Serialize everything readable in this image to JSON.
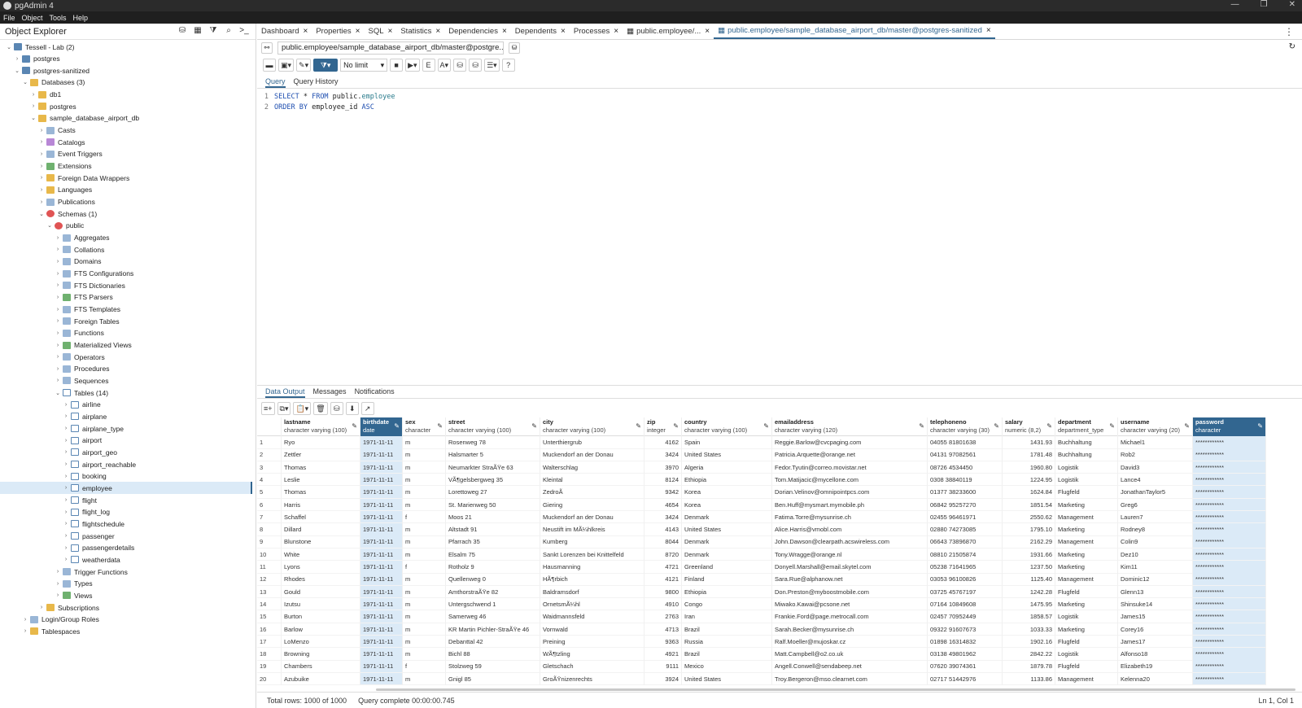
{
  "app": {
    "title": "pgAdmin 4"
  },
  "window_controls": [
    "—",
    "❐",
    "✕"
  ],
  "menu": [
    "File",
    "Object",
    "Tools",
    "Help"
  ],
  "explorer": {
    "title": "Object Explorer",
    "tree": [
      {
        "label": "Tessell - Lab (2)",
        "level": 0,
        "open": true,
        "icon": "srv"
      },
      {
        "label": "postgres",
        "level": 1,
        "open": false,
        "icon": "srv"
      },
      {
        "label": "postgres-sanitized",
        "level": 1,
        "open": true,
        "icon": "srv"
      },
      {
        "label": "Databases (3)",
        "level": 2,
        "open": true,
        "icon": "db"
      },
      {
        "label": "db1",
        "level": 3,
        "open": false,
        "icon": "db"
      },
      {
        "label": "postgres",
        "level": 3,
        "open": false,
        "icon": "db"
      },
      {
        "label": "sample_database_airport_db",
        "level": 3,
        "open": true,
        "icon": "db"
      },
      {
        "label": "Casts",
        "level": 4,
        "open": false,
        "icon": "misc"
      },
      {
        "label": "Catalogs",
        "level": 4,
        "open": false,
        "icon": "pur"
      },
      {
        "label": "Event Triggers",
        "level": 4,
        "open": false,
        "icon": "misc"
      },
      {
        "label": "Extensions",
        "level": 4,
        "open": false,
        "icon": "grn"
      },
      {
        "label": "Foreign Data Wrappers",
        "level": 4,
        "open": false,
        "icon": "db"
      },
      {
        "label": "Languages",
        "level": 4,
        "open": false,
        "icon": "db"
      },
      {
        "label": "Publications",
        "level": 4,
        "open": false,
        "icon": "misc"
      },
      {
        "label": "Schemas (1)",
        "level": 4,
        "open": true,
        "icon": "sch"
      },
      {
        "label": "public",
        "level": 5,
        "open": true,
        "icon": "sch"
      },
      {
        "label": "Aggregates",
        "level": 6,
        "open": false,
        "icon": "misc"
      },
      {
        "label": "Collations",
        "level": 6,
        "open": false,
        "icon": "misc"
      },
      {
        "label": "Domains",
        "level": 6,
        "open": false,
        "icon": "misc"
      },
      {
        "label": "FTS Configurations",
        "level": 6,
        "open": false,
        "icon": "misc"
      },
      {
        "label": "FTS Dictionaries",
        "level": 6,
        "open": false,
        "icon": "misc"
      },
      {
        "label": "FTS Parsers",
        "level": 6,
        "open": false,
        "icon": "grn"
      },
      {
        "label": "FTS Templates",
        "level": 6,
        "open": false,
        "icon": "misc"
      },
      {
        "label": "Foreign Tables",
        "level": 6,
        "open": false,
        "icon": "misc"
      },
      {
        "label": "Functions",
        "level": 6,
        "open": false,
        "icon": "misc"
      },
      {
        "label": "Materialized Views",
        "level": 6,
        "open": false,
        "icon": "grn"
      },
      {
        "label": "Operators",
        "level": 6,
        "open": false,
        "icon": "misc"
      },
      {
        "label": "Procedures",
        "level": 6,
        "open": false,
        "icon": "misc"
      },
      {
        "label": "Sequences",
        "level": 6,
        "open": false,
        "icon": "misc"
      },
      {
        "label": "Tables (14)",
        "level": 6,
        "open": true,
        "icon": "tbl"
      },
      {
        "label": "airline",
        "level": 7,
        "open": false,
        "icon": "tbl"
      },
      {
        "label": "airplane",
        "level": 7,
        "open": false,
        "icon": "tbl"
      },
      {
        "label": "airplane_type",
        "level": 7,
        "open": false,
        "icon": "tbl"
      },
      {
        "label": "airport",
        "level": 7,
        "open": false,
        "icon": "tbl"
      },
      {
        "label": "airport_geo",
        "level": 7,
        "open": false,
        "icon": "tbl"
      },
      {
        "label": "airport_reachable",
        "level": 7,
        "open": false,
        "icon": "tbl"
      },
      {
        "label": "booking",
        "level": 7,
        "open": false,
        "icon": "tbl"
      },
      {
        "label": "employee",
        "level": 7,
        "open": false,
        "icon": "tbl",
        "selected": true
      },
      {
        "label": "flight",
        "level": 7,
        "open": false,
        "icon": "tbl"
      },
      {
        "label": "flight_log",
        "level": 7,
        "open": false,
        "icon": "tbl"
      },
      {
        "label": "flightschedule",
        "level": 7,
        "open": false,
        "icon": "tbl"
      },
      {
        "label": "passenger",
        "level": 7,
        "open": false,
        "icon": "tbl"
      },
      {
        "label": "passengerdetails",
        "level": 7,
        "open": false,
        "icon": "tbl"
      },
      {
        "label": "weatherdata",
        "level": 7,
        "open": false,
        "icon": "tbl"
      },
      {
        "label": "Trigger Functions",
        "level": 6,
        "open": false,
        "icon": "misc"
      },
      {
        "label": "Types",
        "level": 6,
        "open": false,
        "icon": "misc"
      },
      {
        "label": "Views",
        "level": 6,
        "open": false,
        "icon": "grn"
      },
      {
        "label": "Subscriptions",
        "level": 4,
        "open": false,
        "icon": "db"
      },
      {
        "label": "Login/Group Roles",
        "level": 2,
        "open": false,
        "icon": "misc"
      },
      {
        "label": "Tablespaces",
        "level": 2,
        "open": false,
        "icon": "db"
      }
    ]
  },
  "tabs": [
    {
      "label": "Dashboard",
      "active": false
    },
    {
      "label": "Properties",
      "active": false
    },
    {
      "label": "SQL",
      "active": false
    },
    {
      "label": "Statistics",
      "active": false
    },
    {
      "label": "Dependencies",
      "active": false
    },
    {
      "label": "Dependents",
      "active": false
    },
    {
      "label": "Processes",
      "active": false
    },
    {
      "label": "public.employee/...",
      "active": false
    },
    {
      "label": "public.employee/sample_database_airport_db/master@postgres-sanitized",
      "active": true
    }
  ],
  "connection": {
    "value": "public.employee/sample_database_airport_db/master@postgre..."
  },
  "toolbar": {
    "limit_label": "No limit"
  },
  "query_tabs": [
    "Query",
    "Query History"
  ],
  "editor": {
    "lines": [
      {
        "num": "1",
        "parts": [
          [
            "kw",
            "SELECT"
          ],
          [
            "p",
            " * "
          ],
          [
            "kw",
            "FROM"
          ],
          [
            "p",
            " public."
          ],
          [
            "idn",
            "employee"
          ]
        ]
      },
      {
        "num": "2",
        "parts": [
          [
            "kw",
            "ORDER BY"
          ],
          [
            "p",
            " employee_id "
          ],
          [
            "kw",
            "ASC"
          ]
        ]
      }
    ]
  },
  "output_tabs": [
    "Data Output",
    "Messages",
    "Notifications"
  ],
  "grid": {
    "columns": [
      {
        "name": "",
        "type": ""
      },
      {
        "name": "lastname",
        "type": "character varying (100)"
      },
      {
        "name": "birthdate",
        "type": "date"
      },
      {
        "name": "sex",
        "type": "character"
      },
      {
        "name": "street",
        "type": "character varying (100)"
      },
      {
        "name": "city",
        "type": "character varying (100)"
      },
      {
        "name": "zip",
        "type": "integer"
      },
      {
        "name": "country",
        "type": "character varying (100)"
      },
      {
        "name": "emailaddress",
        "type": "character varying (120)"
      },
      {
        "name": "telephoneno",
        "type": "character varying (30)"
      },
      {
        "name": "salary",
        "type": "numeric (8,2)"
      },
      {
        "name": "department",
        "type": "department_type"
      },
      {
        "name": "username",
        "type": "character varying (20)"
      },
      {
        "name": "password",
        "type": "character"
      }
    ],
    "rows": [
      [
        "1",
        "Ryo",
        "1971-11-11",
        "m",
        "Rosenweg 78",
        "Unterthiergrub",
        "4162",
        "Spain",
        "Reggie.Barlow@cvcpaging.com",
        "04055 81801638",
        "1431.93",
        "Buchhaltung",
        "Michael1",
        "************"
      ],
      [
        "2",
        "Zettler",
        "1971-11-11",
        "m",
        "Halsmarter 5",
        "Muckendorf an der Donau",
        "3424",
        "United States",
        "Patricia.Arquette@orange.net",
        "04131 97082561",
        "1781.48",
        "Buchhaltung",
        "Rob2",
        "************"
      ],
      [
        "3",
        "Thomas",
        "1971-11-11",
        "m",
        "Neumarkter StraÃŸe 63",
        "Walterschlag",
        "3970",
        "Algeria",
        "Fedor.Tyutin@correo.movistar.net",
        "08726 4534450",
        "1960.80",
        "Logistik",
        "David3",
        "************"
      ],
      [
        "4",
        "Leslie",
        "1971-11-11",
        "m",
        "VÃ¶gelsbergweg 35",
        "Kleintal",
        "8124",
        "Ethiopia",
        "Tom.Matijacic@mycellone.com",
        "0308 38840119",
        "1224.95",
        "Logistik",
        "Lance4",
        "************"
      ],
      [
        "5",
        "Thomas",
        "1971-11-11",
        "m",
        "Lorettoweg 27",
        "ZedroÃ",
        "9342",
        "Korea",
        "Dorian.Velinov@omnipointpcs.com",
        "01377 38233600",
        "1624.84",
        "Flugfeld",
        "JonathanTaylor5",
        "************"
      ],
      [
        "6",
        "Harris",
        "1971-11-11",
        "m",
        "St. Marienweg 50",
        "Giering",
        "4654",
        "Korea",
        "Ben.Huff@mysmart.mymobile.ph",
        "06842 95257270",
        "1851.54",
        "Marketing",
        "Greg6",
        "************"
      ],
      [
        "7",
        "Schaffel",
        "1971-11-11",
        "f",
        "Moos 21",
        "Muckendorf an der Donau",
        "3424",
        "Denmark",
        "Fatima.Torre@mysunrise.ch",
        "02455 96461971",
        "2550.62",
        "Management",
        "Lauren7",
        "************"
      ],
      [
        "8",
        "Dillard",
        "1971-11-11",
        "m",
        "Altstadt 91",
        "Neustift im MÃ¼hlkreis",
        "4143",
        "United States",
        "Alice.Harris@vmobl.com",
        "02880 74273085",
        "1795.10",
        "Marketing",
        "Rodney8",
        "************"
      ],
      [
        "9",
        "Blunstone",
        "1971-11-11",
        "m",
        "Pfarrach 35",
        "Kumberg",
        "8044",
        "Denmark",
        "John.Dawson@clearpath.acswireless.com",
        "06643 73896870",
        "2162.29",
        "Management",
        "Colin9",
        "************"
      ],
      [
        "10",
        "White",
        "1971-11-11",
        "m",
        "Elsalm 75",
        "Sankt Lorenzen bei Knittelfeld",
        "8720",
        "Denmark",
        "Tony.Wragge@orange.nl",
        "08810 21505874",
        "1931.66",
        "Marketing",
        "Dez10",
        "************"
      ],
      [
        "11",
        "Lyons",
        "1971-11-11",
        "f",
        "Rotholz 9",
        "Hausmanning",
        "4721",
        "Greenland",
        "Donyell.Marshall@email.skytel.com",
        "05238 71641965",
        "1237.50",
        "Marketing",
        "Kim11",
        "************"
      ],
      [
        "12",
        "Rhodes",
        "1971-11-11",
        "m",
        "Quellenweg 0",
        "HÃ¶rbich",
        "4121",
        "Finland",
        "Sara.Rue@alphanow.net",
        "03053 96100826",
        "1125.40",
        "Management",
        "Dominic12",
        "************"
      ],
      [
        "13",
        "Gould",
        "1971-11-11",
        "m",
        "AmthorstraÃŸe 82",
        "Baldramsdorf",
        "9800",
        "Ethiopia",
        "Don.Preston@myboostmobile.com",
        "03725 45767197",
        "1242.28",
        "Flugfeld",
        "Glenn13",
        "************"
      ],
      [
        "14",
        "Izutsu",
        "1971-11-11",
        "m",
        "Untergschwend 1",
        "OrnetsmÃ¼hl",
        "4910",
        "Congo",
        "Miwako.Kawai@pcsone.net",
        "07164 10849608",
        "1475.95",
        "Marketing",
        "Shinsuke14",
        "************"
      ],
      [
        "15",
        "Burton",
        "1971-11-11",
        "m",
        "Samerweg 46",
        "Waidmannsfeld",
        "2763",
        "Iran",
        "Frankie.Ford@page.metrocall.com",
        "02457 70952449",
        "1858.57",
        "Logistik",
        "James15",
        "************"
      ],
      [
        "16",
        "Barlow",
        "1971-11-11",
        "m",
        "KR Martin Pichler-StraÃŸe 46",
        "Vornwald",
        "4713",
        "Brazil",
        "Sarah.Becker@mysunrise.ch",
        "09322 91607673",
        "1033.33",
        "Marketing",
        "Corey16",
        "************"
      ],
      [
        "17",
        "LoMenzo",
        "1971-11-11",
        "m",
        "Debanttal 42",
        "Preining",
        "9363",
        "Russia",
        "Ralf.Moeller@mujoskar.cz",
        "01898 16314832",
        "1902.16",
        "Flugfeld",
        "James17",
        "************"
      ],
      [
        "18",
        "Browning",
        "1971-11-11",
        "m",
        "Bichl 88",
        "WÃ¶tzling",
        "4921",
        "Brazil",
        "Matt.Campbell@o2.co.uk",
        "03138 49801962",
        "2842.22",
        "Logistik",
        "Alfonso18",
        "************"
      ],
      [
        "19",
        "Chambers",
        "1971-11-11",
        "f",
        "Stolzweg 59",
        "Gletschach",
        "9111",
        "Mexico",
        "Angell.Conwell@sendabeep.net",
        "07620 39074361",
        "1879.78",
        "Flugfeld",
        "Elizabeth19",
        "************"
      ],
      [
        "20",
        "Azubuike",
        "1971-11-11",
        "m",
        "Gnigl 85",
        "GroÃŸnizenrechts",
        "3924",
        "United States",
        "Troy.Bergeron@mso.clearnet.com",
        "02717 51442976",
        "1133.86",
        "Management",
        "Kelenna20",
        "************"
      ]
    ]
  },
  "status": {
    "total_rows": "Total rows: 1000 of 1000",
    "query_complete": "Query complete 00:00:00.745",
    "cursor": "Ln 1, Col 1"
  },
  "colors": {
    "accent": "#326690",
    "selection": "#dbeaf7"
  }
}
